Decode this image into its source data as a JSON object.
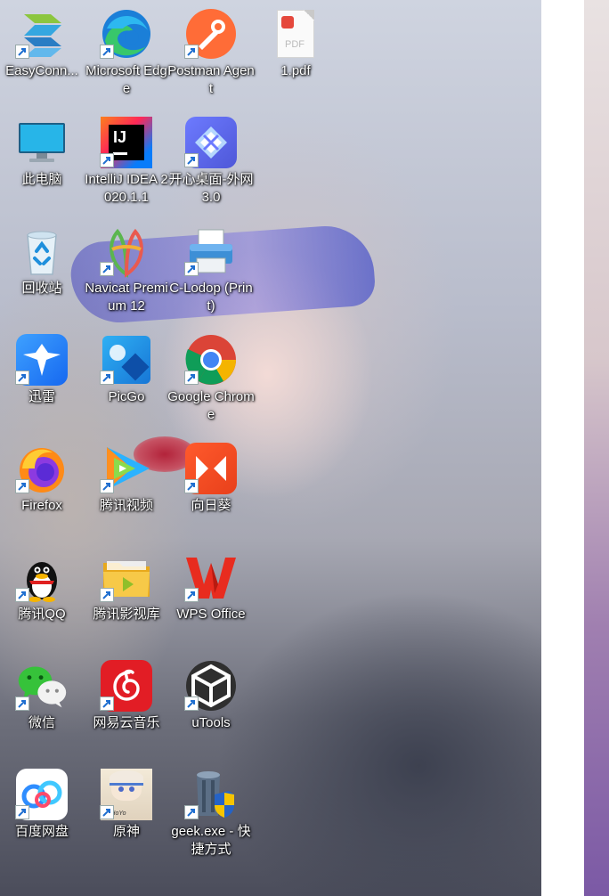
{
  "desktop": {
    "icons": [
      {
        "id": "easyconnect",
        "label": "EasyConn...",
        "icon": "easyconnect-icon",
        "shortcut": true
      },
      {
        "id": "edge",
        "label": "Microsoft Edge",
        "icon": "edge-icon",
        "shortcut": true
      },
      {
        "id": "postman",
        "label": "Postman Agent",
        "icon": "postman-icon",
        "shortcut": true
      },
      {
        "id": "pdf",
        "label": "1.pdf",
        "icon": "pdf-file-icon",
        "badge_text": "PDF",
        "shortcut": false
      },
      {
        "id": "this-pc",
        "label": "此电脑",
        "icon": "monitor-icon",
        "shortcut": false
      },
      {
        "id": "intellij",
        "label": "IntelliJ IDEA 2020.1.1",
        "icon": "intellij-icon",
        "badge_text": "IJ",
        "shortcut": true
      },
      {
        "id": "kaixin",
        "label": "开心桌面-外网 3.0",
        "icon": "kaixin-desktop-icon",
        "shortcut": true
      },
      {
        "id": "recycle",
        "label": "回收站",
        "icon": "recycle-bin-icon",
        "shortcut": false
      },
      {
        "id": "navicat",
        "label": "Navicat Premium 12",
        "icon": "navicat-icon",
        "shortcut": true
      },
      {
        "id": "clodop",
        "label": "C-Lodop (Print)",
        "icon": "printer-icon",
        "shortcut": true
      },
      {
        "id": "xunlei",
        "label": "迅雷",
        "icon": "thunder-icon",
        "shortcut": true
      },
      {
        "id": "picgo",
        "label": "PicGo",
        "icon": "picgo-icon",
        "shortcut": true
      },
      {
        "id": "chrome",
        "label": "Google Chrome",
        "icon": "chrome-icon",
        "shortcut": true
      },
      {
        "id": "firefox",
        "label": "Firefox",
        "icon": "firefox-icon",
        "shortcut": true
      },
      {
        "id": "tencent-video",
        "label": "腾讯视频",
        "icon": "tencent-video-icon",
        "shortcut": true
      },
      {
        "id": "sunflower",
        "label": "向日葵",
        "icon": "sunflower-icon",
        "shortcut": true
      },
      {
        "id": "qq",
        "label": "腾讯QQ",
        "icon": "qq-penguin-icon",
        "shortcut": true
      },
      {
        "id": "video-lib",
        "label": "腾讯影视库",
        "icon": "video-library-folder-icon",
        "shortcut": true
      },
      {
        "id": "wps",
        "label": "WPS Office",
        "icon": "wps-icon",
        "shortcut": true
      },
      {
        "id": "wechat",
        "label": "微信",
        "icon": "wechat-icon",
        "shortcut": true
      },
      {
        "id": "netease-music",
        "label": "网易云音乐",
        "icon": "netease-music-icon",
        "shortcut": true
      },
      {
        "id": "utools",
        "label": "uTools",
        "icon": "utools-icon",
        "shortcut": true
      },
      {
        "id": "baidu-pan",
        "label": "百度网盘",
        "icon": "baidu-netdisk-icon",
        "shortcut": true
      },
      {
        "id": "genshin",
        "label": "原神",
        "icon": "genshin-icon",
        "badge_text": "miHoYo",
        "shortcut": true
      },
      {
        "id": "geek",
        "label": "geek.exe - 快捷方式",
        "icon": "geek-uninstaller-icon",
        "shortcut": true
      }
    ]
  },
  "colors": {
    "label_text": "#ffffff",
    "shortcut_arrow": "#1f6fd0"
  }
}
